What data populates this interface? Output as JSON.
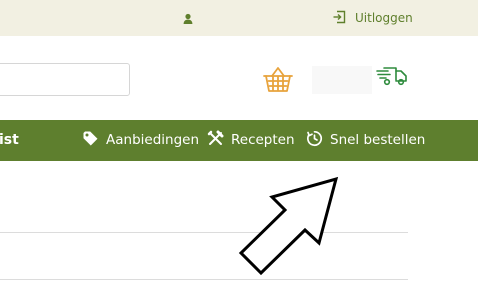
{
  "topbar": {
    "account_icon": "user-icon",
    "logout": {
      "icon": "logout-icon",
      "label": "Uitloggen"
    }
  },
  "header": {
    "search": {
      "value": "",
      "placeholder": ""
    },
    "basket_icon": "basket-icon",
    "delivery_icon": "delivery-truck-icon"
  },
  "nav": {
    "partial_label": "ist",
    "items": [
      {
        "icon": "tag-icon",
        "label": "Aanbiedingen"
      },
      {
        "icon": "utensils-icon",
        "label": "Recepten"
      },
      {
        "icon": "quick-order-icon",
        "label": "Snel bestellen"
      }
    ]
  },
  "colors": {
    "topbar_bg": "#f2f0e2",
    "nav_bg": "#5e7f2e",
    "accent_green": "#5f7f2c",
    "basket_orange": "#e8a33c",
    "truck_green": "#2e8b3d"
  },
  "overlay": {
    "pointer": "arrow-cursor-icon"
  }
}
